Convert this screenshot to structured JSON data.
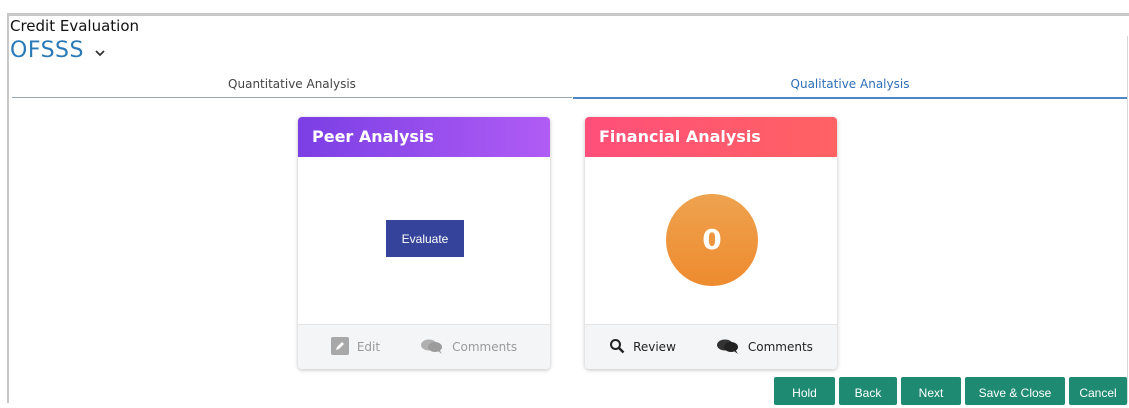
{
  "header": {
    "page_title": "Credit Evaluation",
    "app_name": "OFSSS"
  },
  "tabs": [
    {
      "label": "Quantitative Analysis",
      "active": false
    },
    {
      "label": "Qualitative Analysis",
      "active": true
    }
  ],
  "cards": {
    "peer": {
      "title": "Peer Analysis",
      "evaluate_label": "Evaluate",
      "edit_label": "Edit",
      "comments_label": "Comments"
    },
    "financial": {
      "title": "Financial Analysis",
      "score": "0",
      "review_label": "Review",
      "comments_label": "Comments"
    }
  },
  "actions": {
    "hold": "Hold",
    "back": "Back",
    "next": "Next",
    "save_close": "Save & Close",
    "cancel": "Cancel"
  },
  "colors": {
    "accent_blue": "#2a7ab8",
    "peer_header": "#8e47ee",
    "financial_header": "#ff5572",
    "evaluate_button": "#35439a",
    "score_circle": "#ee922f",
    "action_button": "#1e8a72"
  }
}
